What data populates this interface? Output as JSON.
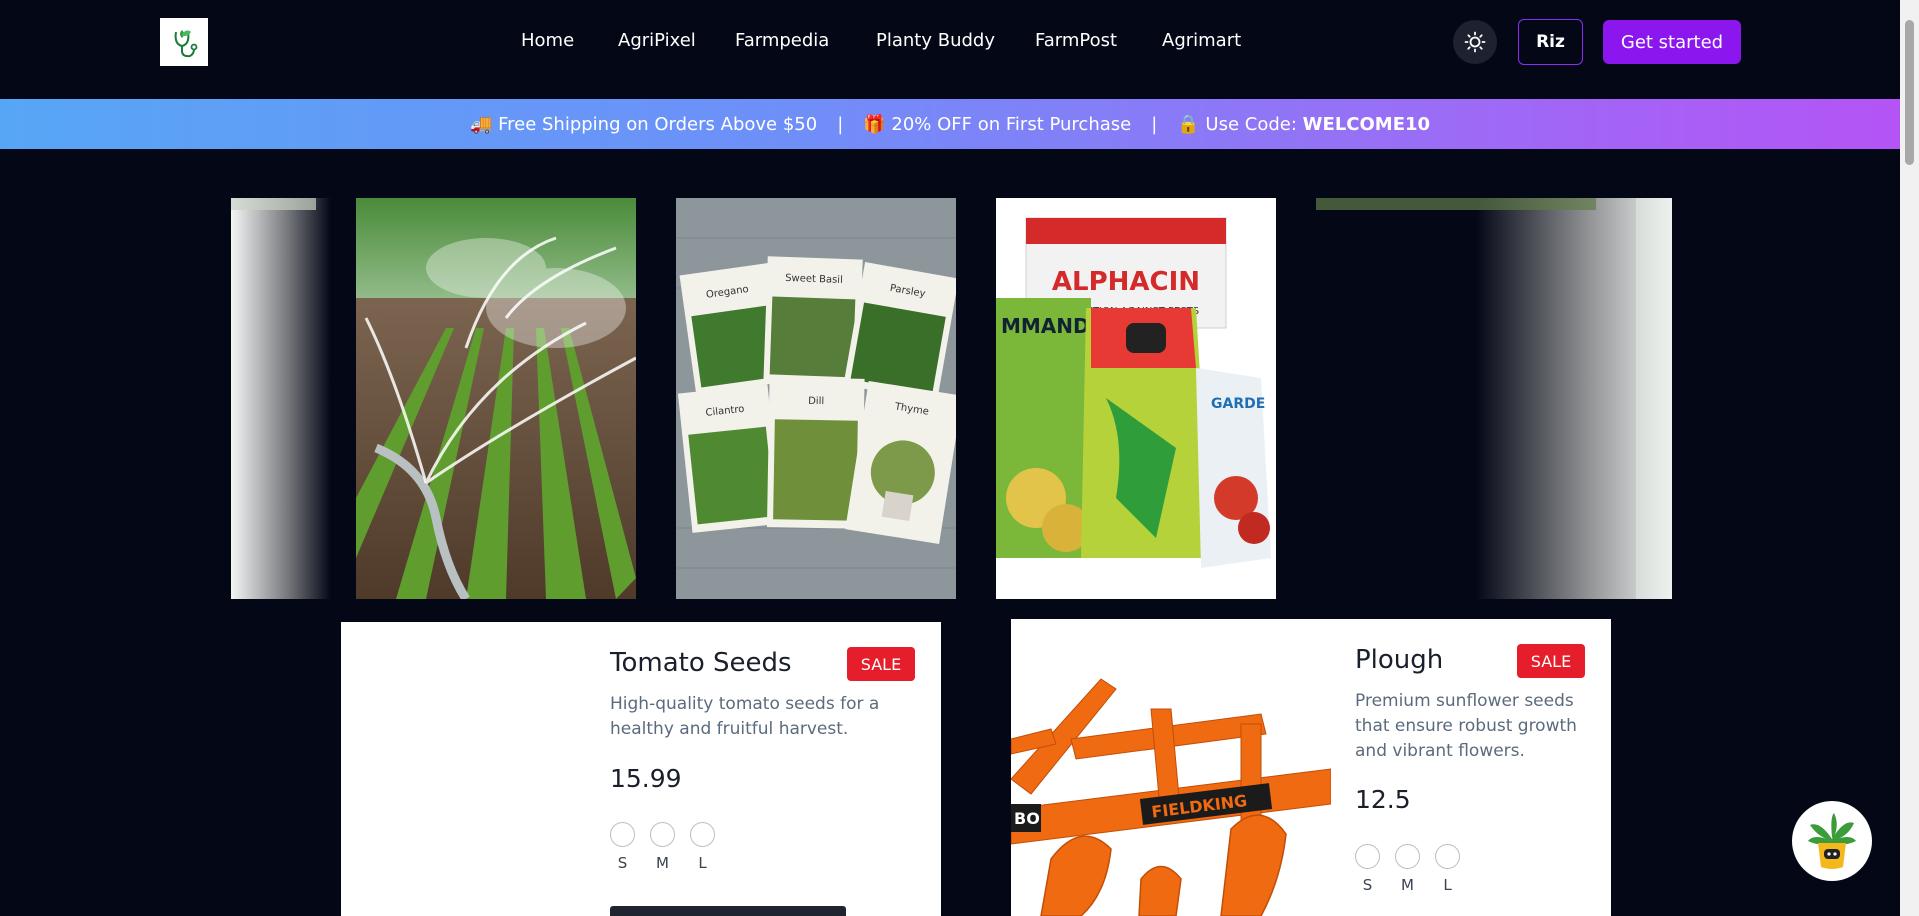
{
  "nav": {
    "items": [
      "Home",
      "AgriPixel",
      "Farmpedia",
      "Planty Buddy",
      "FarmPost",
      "Agrimart"
    ],
    "user_label": "Riz",
    "cta_label": "Get started"
  },
  "promo": {
    "shipping": "🚚 Free Shipping on Orders Above $50",
    "separator": "|",
    "discount": "🎁 20% OFF on First Purchase",
    "code_prefix": "🔒 Use Code:",
    "code": "WELCOME10"
  },
  "slides": [
    {
      "alt": "Irrigation sprinklers"
    },
    {
      "alt": "Herb seed packets"
    },
    {
      "alt": "Pesticide bags"
    }
  ],
  "products": [
    {
      "name": "Tomato Seeds",
      "badge": "SALE",
      "description": "High-quality tomato seeds for a healthy and fruitful harvest.",
      "price": "15.99",
      "sizes": [
        "S",
        "M",
        "L"
      ]
    },
    {
      "name": "Plough",
      "badge": "SALE",
      "description": "Premium sunflower seeds that ensure robust growth and vibrant flowers.",
      "price": "12.5",
      "sizes": [
        "S",
        "M",
        "L"
      ]
    }
  ],
  "packets": [
    "Oregano",
    "Sweet Basil",
    "Parsley",
    "Cilantro",
    "Dill",
    "Thyme"
  ],
  "pesticide": {
    "brand": "ALPHACIN",
    "tagline": "PROTECTION AGAINST PESTS",
    "left": "MMANDER",
    "right": "GARDE"
  },
  "plough_brand": "FIELDKING",
  "colors": {
    "background": "#040816",
    "accent": "#8c16ee",
    "sale": "#e61d2b"
  }
}
